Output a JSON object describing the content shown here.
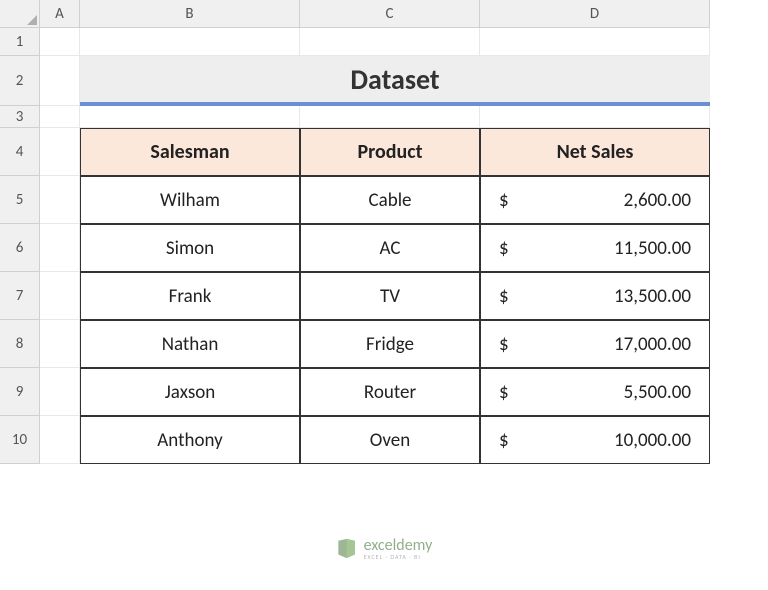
{
  "columns": [
    "A",
    "B",
    "C",
    "D"
  ],
  "rows": [
    "1",
    "2",
    "3",
    "4",
    "5",
    "6",
    "7",
    "8",
    "9",
    "10"
  ],
  "title": "Dataset",
  "headers": {
    "salesman": "Salesman",
    "product": "Product",
    "net_sales": "Net Sales"
  },
  "data": [
    {
      "salesman": "Wilham",
      "product": "Cable",
      "currency": "$",
      "amount": "2,600.00"
    },
    {
      "salesman": "Simon",
      "product": "AC",
      "currency": "$",
      "amount": "11,500.00"
    },
    {
      "salesman": "Frank",
      "product": "TV",
      "currency": "$",
      "amount": "13,500.00"
    },
    {
      "salesman": "Nathan",
      "product": "Fridge",
      "currency": "$",
      "amount": "17,000.00"
    },
    {
      "salesman": "Jaxson",
      "product": "Router",
      "currency": "$",
      "amount": "5,500.00"
    },
    {
      "salesman": "Anthony",
      "product": "Oven",
      "currency": "$",
      "amount": "10,000.00"
    }
  ],
  "watermark": {
    "main": "exceldemy",
    "sub": "EXCEL · DATA · BI"
  }
}
